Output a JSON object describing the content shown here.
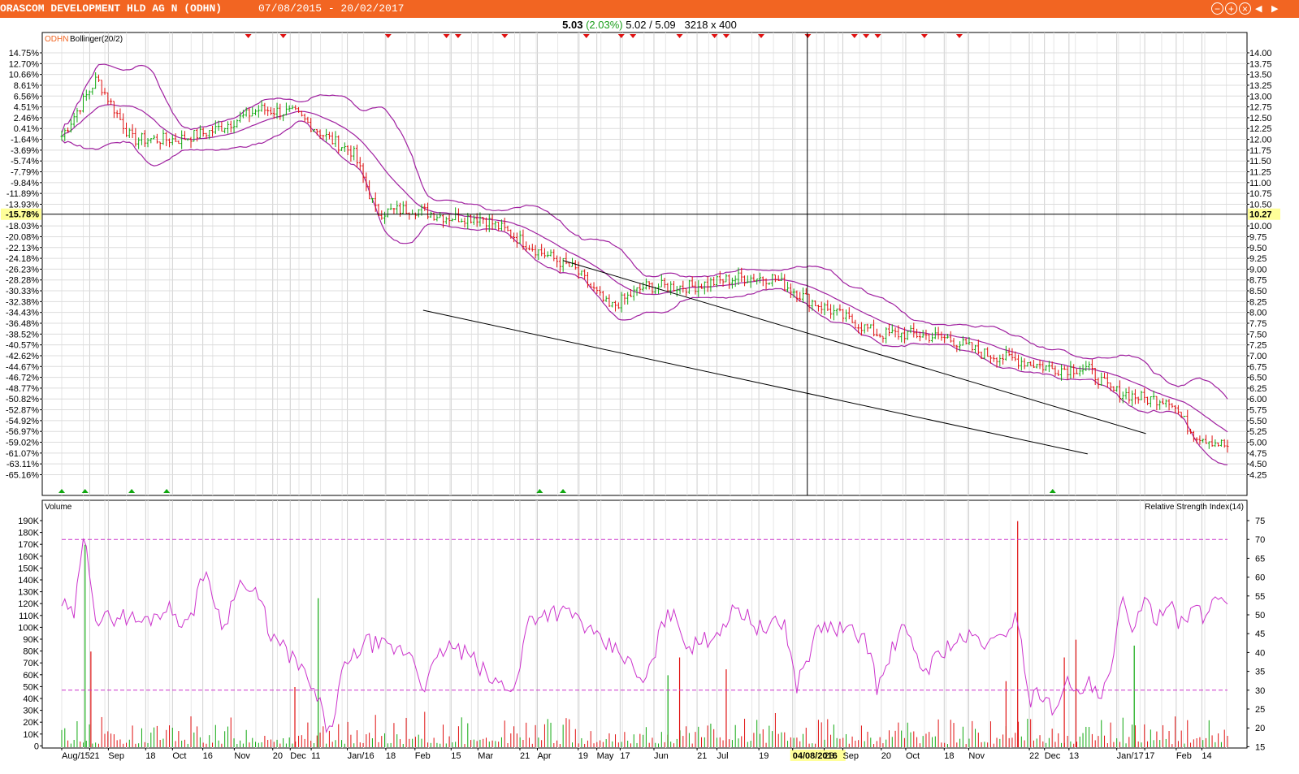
{
  "window": {
    "title": "ORASCOM DEVELOPMENT HLD AG N (ODHN)",
    "date_range": "07/08/2015 - 20/02/2017",
    "icons": [
      "minimize-icon",
      "maximize-icon",
      "close-icon",
      "prev-arrow-icon",
      "next-arrow-icon"
    ]
  },
  "quote": {
    "last": "5.03",
    "change": "(2.03%)",
    "low_high": "5.02 / 5.09",
    "size": "3218 x 400"
  },
  "colors": {
    "titlebar": "#f26522",
    "up": "#10a810",
    "down": "#e01010",
    "band": "#a020a0",
    "rsi": "#cc33cc"
  },
  "chart_data": [
    {
      "type": "candlestick",
      "legend": [
        {
          "name": "ODHN",
          "color": "#f26522"
        },
        {
          "name": "Bollinger(20/2)",
          "color": "#000000"
        }
      ],
      "price_axis_right": [
        "14.00",
        "13.75",
        "13.50",
        "13.25",
        "13.00",
        "12.75",
        "12.50",
        "12.25",
        "12.00",
        "11.75",
        "11.50",
        "11.25",
        "11.00",
        "10.75",
        "10.50",
        "10.27",
        "10.00",
        "9.75",
        "9.50",
        "9.25",
        "9.00",
        "8.75",
        "8.50",
        "8.25",
        "8.00",
        "7.75",
        "7.50",
        "7.25",
        "7.00",
        "6.75",
        "6.50",
        "6.25",
        "6.00",
        "5.75",
        "5.50",
        "5.25",
        "5.00",
        "4.75",
        "4.50",
        "4.25"
      ],
      "pct_axis_left": [
        "14.75%",
        "12.70%",
        "10.66%",
        "8.61%",
        "6.56%",
        "4.51%",
        "2.46%",
        "0.41%",
        "-1.64%",
        "-3.69%",
        "-5.74%",
        "-7.79%",
        "-9.84%",
        "-11.89%",
        "-13.93%",
        "-15.78%",
        "-18.03%",
        "-20.08%",
        "-22.13%",
        "-24.18%",
        "-26.23%",
        "-28.28%",
        "-30.33%",
        "-32.38%",
        "-34.43%",
        "-36.48%",
        "-38.52%",
        "-40.57%",
        "-42.62%",
        "-44.67%",
        "-46.72%",
        "-48.77%",
        "-50.82%",
        "-52.87%",
        "-54.92%",
        "-56.97%",
        "-59.02%",
        "-61.07%",
        "-63.11%",
        "-65.16%"
      ],
      "crosshair": {
        "price": "10.27",
        "pct": "-15.78%",
        "date": "04/08/2016"
      },
      "price_trend": [
        {
          "x": 0.0,
          "y": 12.07
        },
        {
          "x": 0.03,
          "y": 13.4
        },
        {
          "x": 0.06,
          "y": 12.0
        },
        {
          "x": 0.1,
          "y": 12.0
        },
        {
          "x": 0.13,
          "y": 12.2
        },
        {
          "x": 0.17,
          "y": 12.7
        },
        {
          "x": 0.2,
          "y": 12.6
        },
        {
          "x": 0.23,
          "y": 12.0
        },
        {
          "x": 0.25,
          "y": 11.7
        },
        {
          "x": 0.27,
          "y": 10.3
        },
        {
          "x": 0.3,
          "y": 10.4
        },
        {
          "x": 0.33,
          "y": 10.2
        },
        {
          "x": 0.36,
          "y": 10.2
        },
        {
          "x": 0.38,
          "y": 9.9
        },
        {
          "x": 0.41,
          "y": 9.4
        },
        {
          "x": 0.44,
          "y": 9.0
        },
        {
          "x": 0.47,
          "y": 8.1
        },
        {
          "x": 0.5,
          "y": 8.6
        },
        {
          "x": 0.54,
          "y": 8.6
        },
        {
          "x": 0.58,
          "y": 8.8
        },
        {
          "x": 0.61,
          "y": 8.8
        },
        {
          "x": 0.64,
          "y": 8.3
        },
        {
          "x": 0.67,
          "y": 7.9
        },
        {
          "x": 0.7,
          "y": 7.5
        },
        {
          "x": 0.73,
          "y": 7.5
        },
        {
          "x": 0.76,
          "y": 7.4
        },
        {
          "x": 0.79,
          "y": 7.05
        },
        {
          "x": 0.82,
          "y": 6.9
        },
        {
          "x": 0.85,
          "y": 6.7
        },
        {
          "x": 0.88,
          "y": 6.7
        },
        {
          "x": 0.9,
          "y": 6.2
        },
        {
          "x": 0.93,
          "y": 6.0
        },
        {
          "x": 0.95,
          "y": 6.0
        },
        {
          "x": 0.97,
          "y": 5.2
        },
        {
          "x": 1.0,
          "y": 4.9
        }
      ],
      "trendlines": [
        {
          "x1": 0.31,
          "y1": 8.05,
          "x2": 0.88,
          "y2": 4.73
        },
        {
          "x1": 0.43,
          "y1": 9.2,
          "x2": 0.93,
          "y2": 5.2
        }
      ],
      "markers_top": [
        0.16,
        0.19,
        0.28,
        0.33,
        0.34,
        0.38,
        0.45,
        0.48,
        0.49,
        0.53,
        0.56,
        0.57,
        0.6,
        0.64,
        0.68,
        0.69,
        0.7,
        0.74,
        0.77
      ],
      "markers_bottom": [
        0.0,
        0.02,
        0.06,
        0.09,
        0.41,
        0.43,
        0.85
      ]
    },
    {
      "type": "bar+line",
      "title_left": "Volume",
      "title_right": "Relative Strength Index(14)",
      "volume_axis": [
        "190K",
        "180K",
        "170K",
        "160K",
        "150K",
        "140K",
        "130K",
        "120K",
        "110K",
        "100K",
        "90K",
        "80K",
        "70K",
        "60K",
        "50K",
        "40K",
        "30K",
        "20K",
        "10K",
        "0"
      ],
      "rsi_axis": [
        "75",
        "70",
        "65",
        "60",
        "55",
        "50",
        "45",
        "40",
        "35",
        "30",
        "25",
        "20",
        "15"
      ],
      "rsi_levels": [
        70,
        30
      ],
      "rsi_trend": [
        {
          "x": 0.0,
          "y": 53
        },
        {
          "x": 0.01,
          "y": 49
        },
        {
          "x": 0.02,
          "y": 72
        },
        {
          "x": 0.03,
          "y": 48
        },
        {
          "x": 0.05,
          "y": 50
        },
        {
          "x": 0.07,
          "y": 48
        },
        {
          "x": 0.09,
          "y": 52
        },
        {
          "x": 0.11,
          "y": 47
        },
        {
          "x": 0.12,
          "y": 62
        },
        {
          "x": 0.13,
          "y": 55
        },
        {
          "x": 0.14,
          "y": 46
        },
        {
          "x": 0.15,
          "y": 59
        },
        {
          "x": 0.17,
          "y": 54
        },
        {
          "x": 0.18,
          "y": 44
        },
        {
          "x": 0.2,
          "y": 38
        },
        {
          "x": 0.21,
          "y": 33
        },
        {
          "x": 0.22,
          "y": 27
        },
        {
          "x": 0.23,
          "y": 18
        },
        {
          "x": 0.24,
          "y": 34
        },
        {
          "x": 0.26,
          "y": 43
        },
        {
          "x": 0.28,
          "y": 41
        },
        {
          "x": 0.3,
          "y": 40
        },
        {
          "x": 0.31,
          "y": 31
        },
        {
          "x": 0.33,
          "y": 42
        },
        {
          "x": 0.35,
          "y": 39
        },
        {
          "x": 0.37,
          "y": 32
        },
        {
          "x": 0.39,
          "y": 31
        },
        {
          "x": 0.4,
          "y": 49
        },
        {
          "x": 0.42,
          "y": 51
        },
        {
          "x": 0.44,
          "y": 50
        },
        {
          "x": 0.46,
          "y": 43
        },
        {
          "x": 0.48,
          "y": 40
        },
        {
          "x": 0.5,
          "y": 31
        },
        {
          "x": 0.52,
          "y": 52
        },
        {
          "x": 0.54,
          "y": 41
        },
        {
          "x": 0.56,
          "y": 45
        },
        {
          "x": 0.58,
          "y": 52
        },
        {
          "x": 0.6,
          "y": 46
        },
        {
          "x": 0.62,
          "y": 48
        },
        {
          "x": 0.63,
          "y": 31
        },
        {
          "x": 0.65,
          "y": 47
        },
        {
          "x": 0.67,
          "y": 46
        },
        {
          "x": 0.69,
          "y": 44
        },
        {
          "x": 0.7,
          "y": 30
        },
        {
          "x": 0.72,
          "y": 47
        },
        {
          "x": 0.74,
          "y": 35
        },
        {
          "x": 0.76,
          "y": 42
        },
        {
          "x": 0.78,
          "y": 44
        },
        {
          "x": 0.8,
          "y": 42
        },
        {
          "x": 0.82,
          "y": 50
        },
        {
          "x": 0.83,
          "y": 27
        },
        {
          "x": 0.84,
          "y": 30
        },
        {
          "x": 0.85,
          "y": 24
        },
        {
          "x": 0.86,
          "y": 33
        },
        {
          "x": 0.87,
          "y": 28
        },
        {
          "x": 0.88,
          "y": 32
        },
        {
          "x": 0.89,
          "y": 27
        },
        {
          "x": 0.9,
          "y": 34
        },
        {
          "x": 0.91,
          "y": 55
        },
        {
          "x": 0.92,
          "y": 46
        },
        {
          "x": 0.93,
          "y": 53
        },
        {
          "x": 0.94,
          "y": 49
        },
        {
          "x": 0.95,
          "y": 55
        },
        {
          "x": 0.96,
          "y": 47
        },
        {
          "x": 0.97,
          "y": 52
        },
        {
          "x": 0.98,
          "y": 49
        },
        {
          "x": 0.99,
          "y": 55
        },
        {
          "x": 1.0,
          "y": 54
        }
      ],
      "volume_spikes": [
        {
          "x": 0.02,
          "v": 170000,
          "c": "up"
        },
        {
          "x": 0.025,
          "v": 80000,
          "c": "down"
        },
        {
          "x": 0.2,
          "v": 50000,
          "c": "down"
        },
        {
          "x": 0.22,
          "v": 125000,
          "c": "up"
        },
        {
          "x": 0.52,
          "v": 60000,
          "c": "up"
        },
        {
          "x": 0.53,
          "v": 75000,
          "c": "down"
        },
        {
          "x": 0.57,
          "v": 65000,
          "c": "down"
        },
        {
          "x": 0.82,
          "v": 190000,
          "c": "down"
        },
        {
          "x": 0.81,
          "v": 55000,
          "c": "down"
        },
        {
          "x": 0.86,
          "v": 75000,
          "c": "down"
        },
        {
          "x": 0.87,
          "v": 90000,
          "c": "down"
        },
        {
          "x": 0.92,
          "v": 85000,
          "c": "up"
        }
      ]
    }
  ],
  "x_axis_labels": [
    {
      "label": "Aug/15",
      "x": 0.0
    },
    {
      "label": "21",
      "x": 0.024
    },
    {
      "label": "Sep",
      "x": 0.04
    },
    {
      "label": "18",
      "x": 0.072
    },
    {
      "label": "Oct",
      "x": 0.095
    },
    {
      "label": "16",
      "x": 0.121
    },
    {
      "label": "Nov",
      "x": 0.148
    },
    {
      "label": "20",
      "x": 0.181
    },
    {
      "label": "Dec",
      "x": 0.196
    },
    {
      "label": "11",
      "x": 0.214
    },
    {
      "label": "Jan/16",
      "x": 0.245
    },
    {
      "label": "18",
      "x": 0.278
    },
    {
      "label": "Feb",
      "x": 0.303
    },
    {
      "label": "15",
      "x": 0.334
    },
    {
      "label": "Mar",
      "x": 0.357
    },
    {
      "label": "21",
      "x": 0.393
    },
    {
      "label": "Apr",
      "x": 0.408
    },
    {
      "label": "19",
      "x": 0.443
    },
    {
      "label": "May",
      "x": 0.459
    },
    {
      "label": "17",
      "x": 0.479
    },
    {
      "label": "Jun",
      "x": 0.508
    },
    {
      "label": "21",
      "x": 0.545
    },
    {
      "label": "Jul",
      "x": 0.562
    },
    {
      "label": "19",
      "x": 0.598
    },
    {
      "label": "04/08/2016",
      "x": 0.627
    },
    {
      "label": "23",
      "x": 0.654
    },
    {
      "label": "Sep",
      "x": 0.67
    },
    {
      "label": "20",
      "x": 0.703
    },
    {
      "label": "Oct",
      "x": 0.724
    },
    {
      "label": "18",
      "x": 0.757
    },
    {
      "label": "Nov",
      "x": 0.778
    },
    {
      "label": "22",
      "x": 0.83
    },
    {
      "label": "Dec",
      "x": 0.843
    },
    {
      "label": "13",
      "x": 0.864
    },
    {
      "label": "Jan/17",
      "x": 0.905
    },
    {
      "label": "17",
      "x": 0.929
    },
    {
      "label": "Feb",
      "x": 0.956
    },
    {
      "label": "14",
      "x": 0.978
    }
  ]
}
